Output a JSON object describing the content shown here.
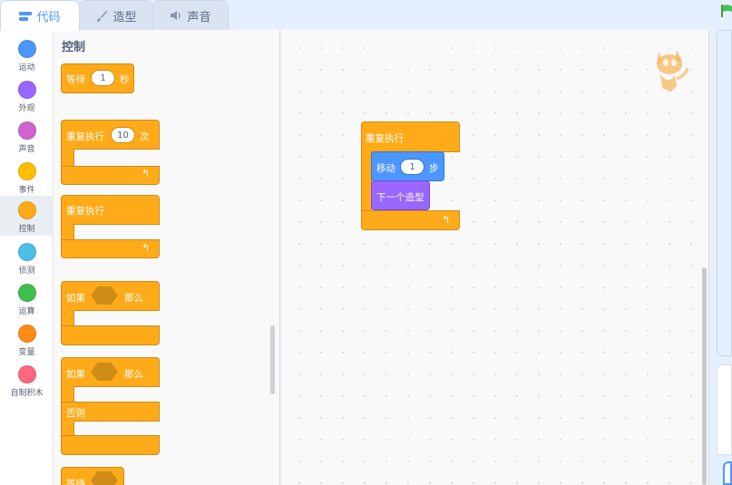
{
  "tabs": [
    {
      "label": "代码",
      "icon": "code-icon"
    },
    {
      "label": "造型",
      "icon": "brush-icon"
    },
    {
      "label": "声音",
      "icon": "speaker-icon"
    }
  ],
  "categories": [
    {
      "label": "运动",
      "color": "#4c97ff"
    },
    {
      "label": "外观",
      "color": "#9966ff"
    },
    {
      "label": "声音",
      "color": "#cf63cf"
    },
    {
      "label": "事件",
      "color": "#ffbf00"
    },
    {
      "label": "控制",
      "color": "#ffab19"
    },
    {
      "label": "侦测",
      "color": "#4cbfe6"
    },
    {
      "label": "运算",
      "color": "#40bf4a"
    },
    {
      "label": "变量",
      "color": "#ff8c1a"
    },
    {
      "label": "自制积木",
      "color": "#ff6680"
    }
  ],
  "palette": {
    "title": "控制",
    "wait": {
      "label": "等待",
      "value": "1",
      "unit": "秒"
    },
    "repeat": {
      "label": "重复执行",
      "value": "10",
      "unit": "次"
    },
    "forever": {
      "label": "重复执行"
    },
    "if_then": {
      "label": "如果",
      "then": "那么"
    },
    "if_else": {
      "label": "如果",
      "then": "那么",
      "else": "否则"
    },
    "wait_until": {
      "label": "等待"
    }
  },
  "script": {
    "forever": {
      "label": "重复执行"
    },
    "move": {
      "label": "移动",
      "value": "1",
      "unit": "步"
    },
    "next_costume": {
      "label": "下一个造型"
    }
  }
}
